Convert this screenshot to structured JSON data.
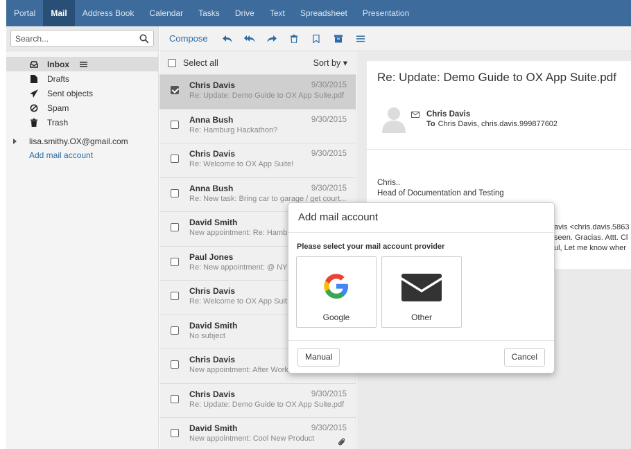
{
  "nav": {
    "tabs": [
      "Portal",
      "Mail",
      "Address Book",
      "Calendar",
      "Tasks",
      "Drive",
      "Text",
      "Spreadsheet",
      "Presentation"
    ],
    "active": "Mail"
  },
  "search": {
    "placeholder": "Search..."
  },
  "folders": [
    {
      "label": "Inbox",
      "icon": "inbox-icon"
    },
    {
      "label": "Drafts",
      "icon": "file-icon"
    },
    {
      "label": "Sent objects",
      "icon": "send-icon"
    },
    {
      "label": "Spam",
      "icon": "ban-icon"
    },
    {
      "label": "Trash",
      "icon": "trash-icon"
    }
  ],
  "account": {
    "email": "lisa.smithy.OX@gmail.com",
    "add_label": "Add mail account"
  },
  "toolbar": {
    "compose": "Compose",
    "icons": [
      "reply-icon",
      "reply-all-icon",
      "forward-icon",
      "delete-icon",
      "flag-icon",
      "archive-icon",
      "menu-icon"
    ]
  },
  "list": {
    "select_all": "Select all",
    "sort_by": "Sort by ▾",
    "mails": [
      {
        "from": "Chris Davis",
        "date": "9/30/2015",
        "subject": "Re: Update: Demo Guide to OX App Suite.pdf",
        "selected": true
      },
      {
        "from": "Anna Bush",
        "date": "9/30/2015",
        "subject": "Re: Hamburg Hackathon?"
      },
      {
        "from": "Chris Davis",
        "date": "9/30/2015",
        "subject": "Re: Welcome to OX App Suite!"
      },
      {
        "from": "Anna Bush",
        "date": "9/30/2015",
        "subject": "Re: New task: Bring car to garage / get court..."
      },
      {
        "from": "David Smith",
        "date": "",
        "subject": "New appointment: Re: Hamb"
      },
      {
        "from": "Paul Jones",
        "date": "",
        "subject": "Re: New appointment: @ NY"
      },
      {
        "from": "Chris Davis",
        "date": "",
        "subject": "Re: Welcome to OX App Suit"
      },
      {
        "from": "David Smith",
        "date": "",
        "subject": "No subject"
      },
      {
        "from": "Chris Davis",
        "date": "",
        "subject": "New appointment: After Work"
      },
      {
        "from": "Chris Davis",
        "date": "9/30/2015",
        "subject": "Re: Update: Demo Guide to OX App Suite.pdf"
      },
      {
        "from": "David Smith",
        "date": "9/30/2015",
        "subject": "New appointment: Cool New Product",
        "attachment": true
      }
    ]
  },
  "reading": {
    "title": "Re: Update: Demo Guide to OX App Suite.pdf",
    "sender": "Chris Davis",
    "to_label": "To",
    "to_value": "Chris Davis,   chris.davis.999877602",
    "body_line1": "Chris..",
    "body_line2": "Head of Documentation and Testing",
    "quote_line1": "avis <chris.davis.5863",
    "quote_line2": "seen. Gracias. Attt. Cl",
    "quote_line3": "ul, Let me know wher"
  },
  "modal": {
    "title": "Add mail account",
    "hint": "Please select your mail account provider",
    "providers": [
      {
        "label": "Google",
        "icon": "google-icon"
      },
      {
        "label": "Other",
        "icon": "envelope-icon"
      }
    ],
    "manual": "Manual",
    "cancel": "Cancel"
  },
  "colors": {
    "nav": "#3c6b9c",
    "nav_active": "#2a4f76",
    "link": "#2d6aa5"
  }
}
